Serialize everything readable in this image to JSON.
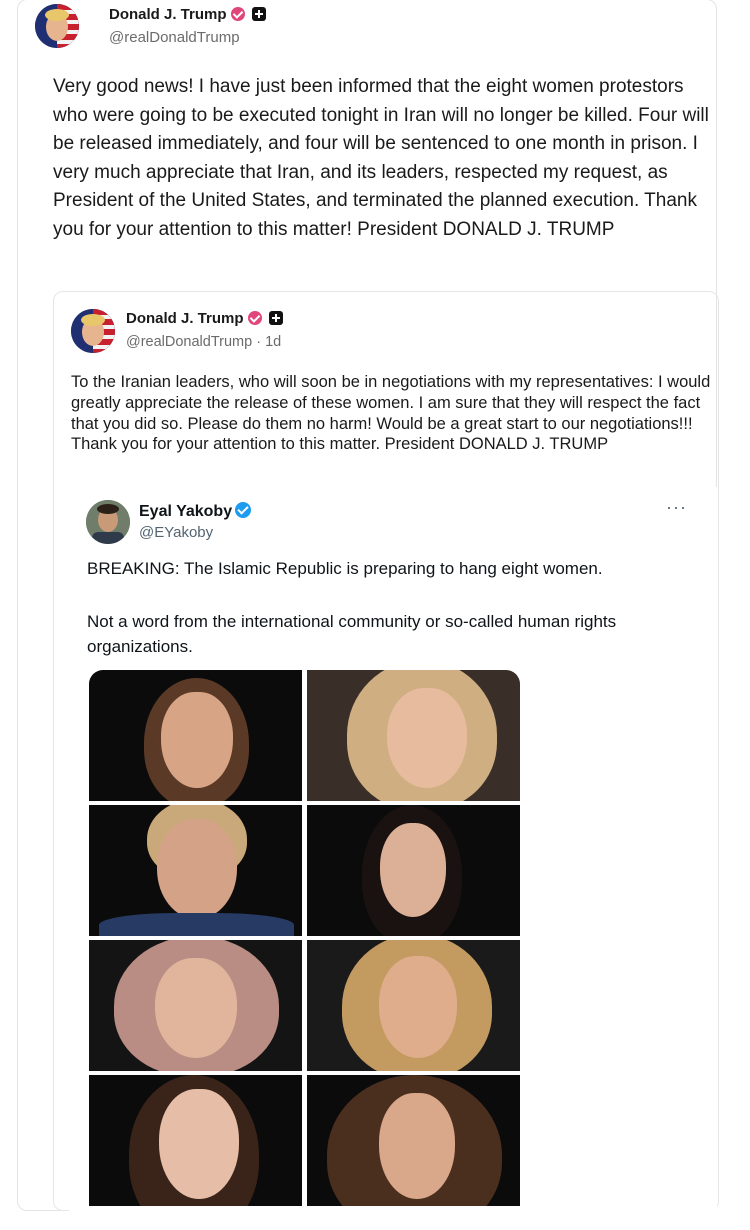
{
  "post": {
    "author_name": "Donald J. Trump",
    "author_handle": "@realDonaldTrump",
    "text": "Very good news! I have just been informed that the eight women protestors who were going to be executed tonight in Iran will no longer be killed. Four will be released immediately, and four will be sentenced to one month in prison. I very much appreciate that Iran, and its leaders, respected my request, as President of the United States, and terminated the planned execution. Thank you for your attention to this matter! President DONALD J. TRUMP",
    "verified_icon": "verified-check-icon",
    "subscriber_icon": "plus-badge-icon"
  },
  "quoted_post": {
    "author_name": "Donald J. Trump",
    "author_handle": "@realDonaldTrump · 1d",
    "text": "To the Iranian leaders, who will soon be in negotiations with my representatives: I would greatly appreciate the release of these women. I am sure that they will respect the fact that you did so. Please do them no harm! Would be a great start to our negotiations!!! Thank you for your attention to this matter. President DONALD J. TRUMP"
  },
  "embedded_tweet": {
    "author_name": "Eyal Yakoby",
    "author_handle": "@EYakoby",
    "more_label": "···",
    "line1": "BREAKING: The Islamic Republic is preparing to hang eight women.",
    "line2": "Not a word from the international community or so-called human rights organizations.",
    "photo_count": 8
  },
  "colors": {
    "badge_pink": "#e0457b",
    "badge_blue": "#1d9bf0",
    "border": "#e4e4e4",
    "handle_gray": "#6b6b6b"
  }
}
